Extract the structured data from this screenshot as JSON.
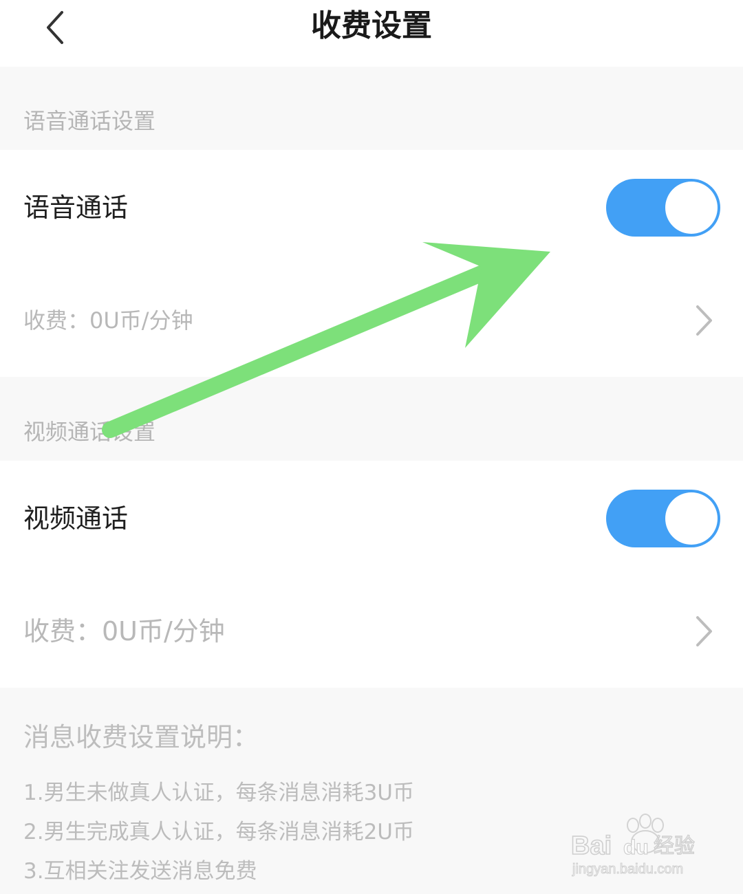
{
  "header": {
    "title": "收费设置"
  },
  "voice": {
    "section_label": "语音通话设置",
    "row_title": "语音通话",
    "fee": "收费：0U币/分钟",
    "toggle_on": true
  },
  "video": {
    "section_label": "视频通话设置",
    "row_title": "视频通话",
    "fee": "收费：0U币/分钟",
    "toggle_on": true
  },
  "notes": {
    "title": "消息收费设置说明：",
    "items": [
      "1.男生未做真人认证，每条消息消耗3U币",
      "2.男生完成真人认证，每条消息消耗2U币",
      "3.互相关注发送消息免费"
    ]
  },
  "watermark": {
    "brand": "Baidu经验",
    "url": "jingyan.baidu.com"
  },
  "colors": {
    "toggle_accent": "#42a0f5",
    "annotation_arrow": "#7de07a"
  },
  "icons": {
    "back": "back-arrow-icon",
    "chevron": "chevron-right-icon"
  }
}
